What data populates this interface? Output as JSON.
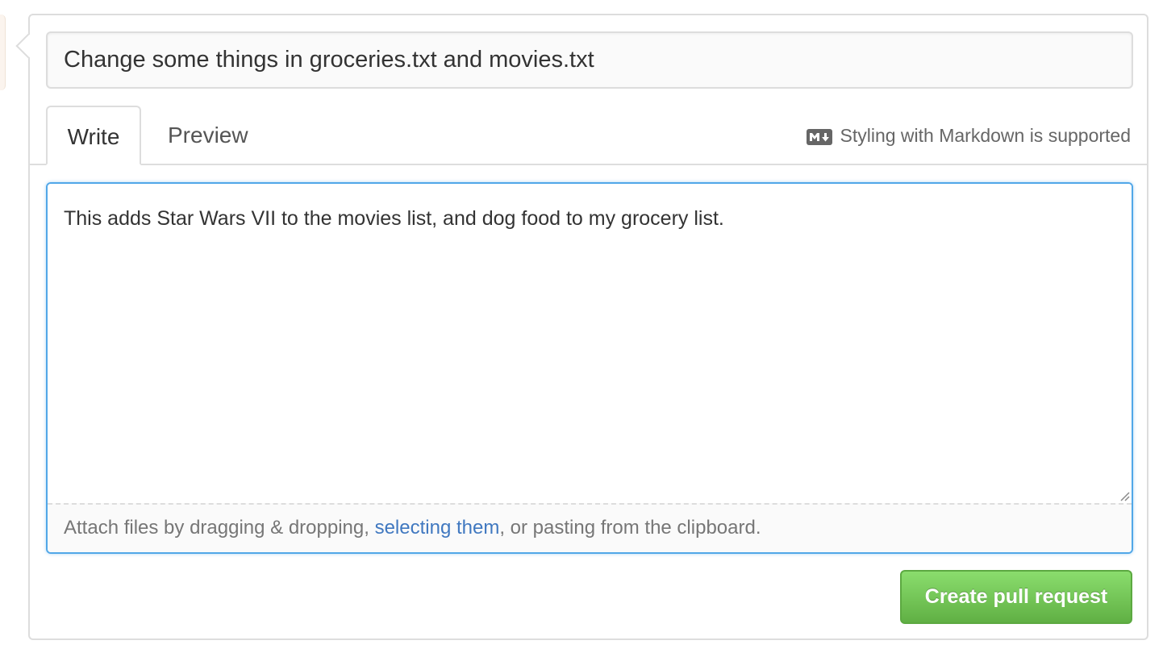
{
  "pull_request": {
    "title_value": "Change some things in groceries.txt and movies.txt",
    "tabs": [
      {
        "label": "Write"
      },
      {
        "label": "Preview"
      }
    ],
    "markdown_note": "Styling with Markdown is supported",
    "markdown_icon": "markdown-icon",
    "body_value": "This adds Star Wars VII to the movies list, and dog food to my grocery list.",
    "attach": {
      "prefix": "Attach files by dragging & dropping, ",
      "link": "selecting them",
      "suffix": ", or pasting from the clipboard."
    },
    "submit_label": "Create pull request"
  },
  "colors": {
    "focus_border": "#51a7e8",
    "link": "#4078c0",
    "button_green": "#60b044"
  }
}
